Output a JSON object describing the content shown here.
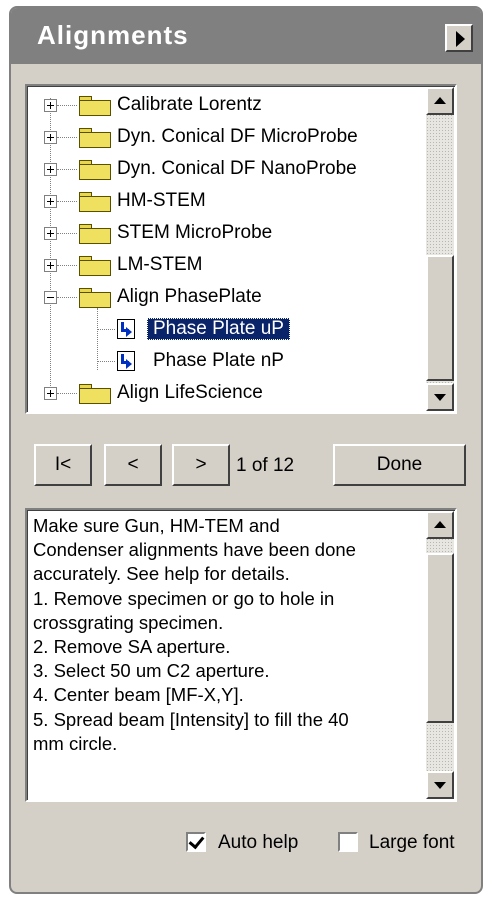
{
  "window": {
    "title": "Alignments"
  },
  "tree": {
    "items": [
      {
        "label": "Calibrate Lorentz",
        "type": "folder",
        "expander": "+"
      },
      {
        "label": "Dyn. Conical DF MicroProbe",
        "type": "folder",
        "expander": "+"
      },
      {
        "label": "Dyn. Conical DF NanoProbe",
        "type": "folder",
        "expander": "+"
      },
      {
        "label": "HM-STEM",
        "type": "folder",
        "expander": "+"
      },
      {
        "label": "STEM MicroProbe",
        "type": "folder",
        "expander": "+"
      },
      {
        "label": "LM-STEM",
        "type": "folder",
        "expander": "+"
      },
      {
        "label": "Align PhasePlate",
        "type": "folder",
        "expander": "-"
      },
      {
        "label": "Phase Plate uP",
        "type": "procedure",
        "selected": true
      },
      {
        "label": "Phase Plate nP",
        "type": "procedure"
      },
      {
        "label": "Align LifeScience",
        "type": "folder",
        "expander": "+"
      }
    ]
  },
  "navigation": {
    "first_label": "I<",
    "prev_label": "<",
    "next_label": ">",
    "position": "1 of 12",
    "done_label": "Done"
  },
  "help": {
    "text": "Make sure Gun, HM-TEM and\nCondenser alignments have been done\naccurately. See help for details.\n1. Remove specimen or go to hole in\ncrossgrating specimen.\n2. Remove SA aperture.\n3. Select 50 um C2 aperture.\n4. Center beam [MF-X,Y].\n5. Spread beam [Intensity] to fill the 40\nmm circle."
  },
  "options": {
    "auto_help": {
      "label": "Auto help",
      "checked": true
    },
    "large_font": {
      "label": "Large font",
      "checked": false
    }
  },
  "colors": {
    "title_bar": "#808080",
    "panel": "#d4d0c8",
    "selection": "#0a246a",
    "folder": "#f0e060",
    "procedure_icon": "#0030c0"
  },
  "icons": {
    "collapse_button": "triangle-right-icon",
    "folder": "folder-icon",
    "procedure": "procedure-icon",
    "expand": "plus-box-icon",
    "collapse": "minus-box-icon"
  }
}
